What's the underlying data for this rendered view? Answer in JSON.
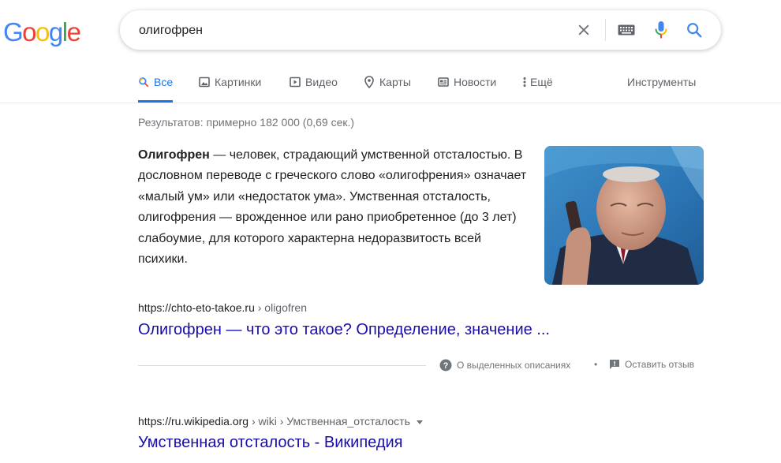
{
  "logo": {
    "letters": [
      "G",
      "o",
      "o",
      "g",
      "l",
      "e"
    ],
    "colors": [
      "#4285F4",
      "#EA4335",
      "#FBBC05",
      "#4285F4",
      "#34A853",
      "#EA4335"
    ]
  },
  "search": {
    "query": "олигофрен"
  },
  "icons": {
    "clear": "close-icon",
    "keyboard": "keyboard-icon",
    "voice": "microphone-icon",
    "search": "search-icon"
  },
  "tabs": [
    {
      "label": "Все",
      "icon": "search-icon",
      "active": true
    },
    {
      "label": "Картинки",
      "icon": "image-icon"
    },
    {
      "label": "Видео",
      "icon": "video-icon"
    },
    {
      "label": "Карты",
      "icon": "map-pin-icon"
    },
    {
      "label": "Новости",
      "icon": "news-icon"
    },
    {
      "label": "Ещё",
      "icon": "more-vert-icon"
    }
  ],
  "tools_label": "Инструменты",
  "stats": "Результатов: примерно 182 000 (0,69 сек.)",
  "featured": {
    "term": "Олигофрен",
    "text": " — человек, страдающий умственной отсталостью. В дословном переводе с греческого слово «олигофрения» означает «малый ум» или «недостаток ума». Умственная отсталость, олигофрения — врожденное или рано приобретенное (до 3 лет) слабоумие, для которого характерна недоразвитость всей психики."
  },
  "results": [
    {
      "domain": "https://chto-eto-takoe.ru",
      "path": " › oligofren",
      "title": "Олигофрен — что это такое? Определение, значение ..."
    },
    {
      "domain": "https://ru.wikipedia.org",
      "path": " › wiki › Умственная_отсталость",
      "title": "Умственная отсталость - Википедия"
    }
  ],
  "feedback": {
    "about_label": "О выделенных описаниях",
    "separator": "•",
    "feedback_label": "Оставить отзыв"
  },
  "colors": {
    "link": "#1a0dab",
    "accent": "#1a73e8",
    "muted": "#70757a"
  }
}
